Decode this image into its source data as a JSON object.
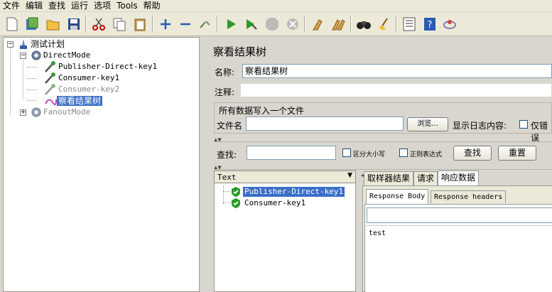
{
  "menu": [
    "文件",
    "编辑",
    "查找",
    "运行",
    "选项",
    "Tools",
    "帮助"
  ],
  "toolbar_icons": [
    "new-icon",
    "templates-icon",
    "open-icon",
    "save-icon",
    "cut-icon",
    "copy-icon",
    "paste-icon",
    "expand-icon",
    "collapse-icon",
    "toggle-icon",
    "start-icon",
    "start-no-pause-icon",
    "stop-icon",
    "shutdown-icon",
    "clear-icon",
    "clear-all-icon",
    "search-icon",
    "reset-search-icon",
    "function-helper-icon",
    "help-icon",
    "remote-icon"
  ],
  "tree": {
    "root": "测试计划",
    "directmode": "DirectMode",
    "publisher": "Publisher-Direct-key1",
    "consumer1": "Consumer-key1",
    "consumer2": "Consumer-key2",
    "listener": "察看结果树",
    "fanoutmode": "FanoutMode"
  },
  "panel": {
    "title": "察看结果树",
    "name_label": "名称:",
    "name_value": "察看结果树",
    "comment_label": "注释:",
    "comment_value": "",
    "file_group_label": "所有数据写入一个文件",
    "filename_label": "文件名",
    "filename_value": "",
    "browse_button": "浏览...",
    "log_label": "显示日志内容:",
    "errors_only_label": "仅错误"
  },
  "search": {
    "label": "查找:",
    "value": "",
    "case_label": "区分大小写",
    "regex_label": "正则表达式",
    "find_button": "查找",
    "reset_button": "重置"
  },
  "results": {
    "renderer": "Text",
    "items": [
      "Publisher-Direct-key1",
      "Consumer-key1"
    ]
  },
  "detail": {
    "tabs": [
      "取样器结果",
      "请求",
      "响应数据"
    ],
    "subtabs": [
      "Response Body",
      "Response headers"
    ],
    "body": "test"
  }
}
